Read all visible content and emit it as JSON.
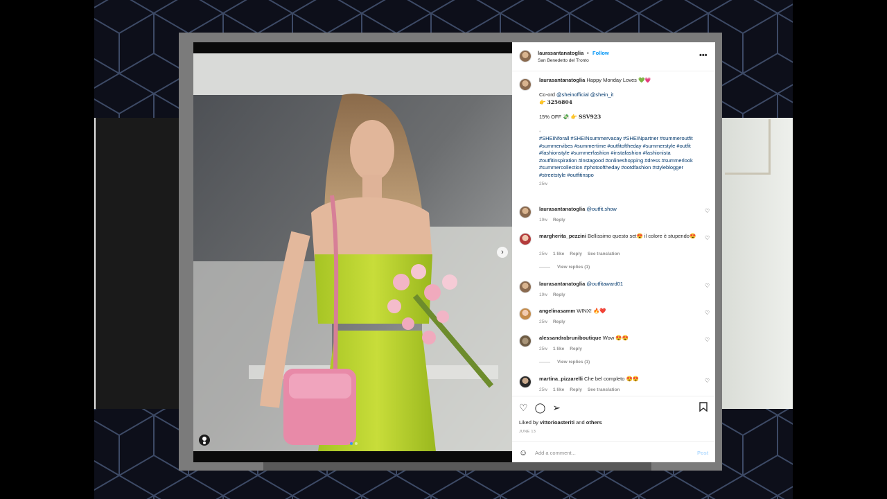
{
  "post": {
    "username": "laurasantanatoglia",
    "follow_separator": "•",
    "follow_label": "Follow",
    "location": "San Benedetto del Tronto",
    "more_glyph": "•••"
  },
  "caption": {
    "username": "laurasantanatoglia",
    "title": "Happy Monday Loves 💚💗",
    "coord_prefix": "Co-ord",
    "mention1": "@sheinofficial",
    "mention2": "@shein_it",
    "code1_prefix": "👉",
    "code1": "3256804",
    "discount": "15% OFF 💸 👉",
    "code2": "SSV923",
    "spacer": "•",
    "hashtags": "#SHEINforall #SHEINsummervacay #SHEINpartner #summeroutfit #summervibes #summertime #outfitoftheday #summerstyle #outfit #fashionstyle #summerfashion #instafashion #fashionista #outfitinspiration #instagood #onlineshopping #dress #summerlook #summercollection #photooftheday #ootdfashion #styleblogger #streetstyle #outfitinspo",
    "time": "25w"
  },
  "comments": [
    {
      "user": "laurasantanatoglia",
      "text": "@outfit.show",
      "time": "19w",
      "likes": "",
      "reply": "Reply",
      "translate": ""
    },
    {
      "user": "margherita_pezzini",
      "text": "Bellissimo questo set😍 il colore è stupendo😍",
      "time": "25w",
      "likes": "1 like",
      "reply": "Reply",
      "translate": "See translation"
    },
    {
      "user": "laurasantanatoglia",
      "text": "@outfitaward01",
      "time": "19w",
      "likes": "",
      "reply": "Reply",
      "translate": ""
    },
    {
      "user": "angelinasamm",
      "text": "WINX! 🔥❤️",
      "time": "25w",
      "likes": "",
      "reply": "Reply",
      "translate": ""
    },
    {
      "user": "alessandrabruniboutique",
      "text": "Wow 😍😍",
      "time": "25w",
      "likes": "1 like",
      "reply": "Reply",
      "translate": ""
    },
    {
      "user": "martina_pizzarelli",
      "text": "Che bel completo 😍😍",
      "time": "25w",
      "likes": "1 like",
      "reply": "Reply",
      "translate": "See translation"
    }
  ],
  "view_replies": [
    "View replies (1)",
    "View replies (1)"
  ],
  "actions": {
    "liked_prefix": "Liked by",
    "liked_user": "vittorioasteriti",
    "liked_and": "and",
    "liked_others": "others",
    "date": "JUNE 13"
  },
  "add_comment": {
    "placeholder": "Add a comment...",
    "post_label": "Post"
  },
  "icons": {
    "heart": "heart-icon",
    "comment": "comment-icon",
    "share": "share-icon",
    "bookmark": "bookmark-icon",
    "emoji": "emoji-icon"
  },
  "colors": {
    "follow": "#0095f6",
    "hashtag": "#00376b",
    "muted": "#8e8e8e",
    "post_disabled": "#b3dbff"
  }
}
